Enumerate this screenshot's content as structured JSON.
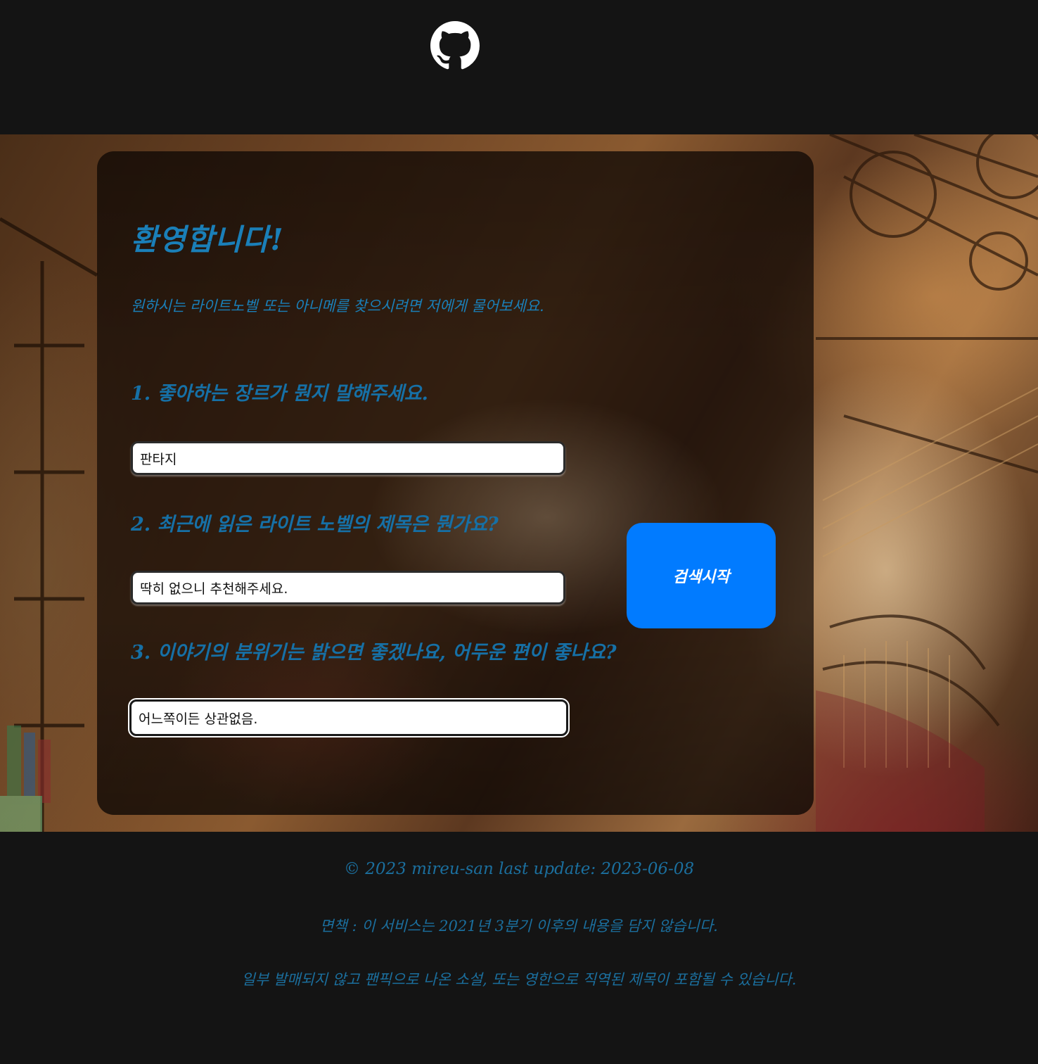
{
  "header": {
    "github_icon": "github-icon"
  },
  "card": {
    "title": "환영합니다!",
    "subtitle": "원하시는 라이트노벨 또는 아니메를 찾으시려면 저에게 물어보세요.",
    "questions": [
      {
        "label": "1. 좋아하는 장르가 뭔지 말해주세요.",
        "value": "판타지"
      },
      {
        "label": "2. 최근에 읽은 라이트 노벨의 제목은 뭔가요?",
        "value": "딱히 없으니 추천해주세요."
      },
      {
        "label": "3. 이야기의 분위기는 밝으면 좋겠나요, 어두운 편이 좋나요?",
        "value": "어느쪽이든 상관없음."
      }
    ],
    "search_button": "검색시작"
  },
  "footer": {
    "copyright": "© 2023 mireu-san last update: 2023-06-08",
    "disclaimer_1": "면책 : 이 서비스는 2021년 3분기 이후의 내용을 담지 않습니다.",
    "disclaimer_2": "일부 발매되지 않고 팬픽으로 나온 소설, 또는 영한으로 직역된 제목이 포함될 수 있습니다."
  },
  "colors": {
    "accent_text": "#1a7fb8",
    "button": "#017bff",
    "background": "#141414"
  }
}
